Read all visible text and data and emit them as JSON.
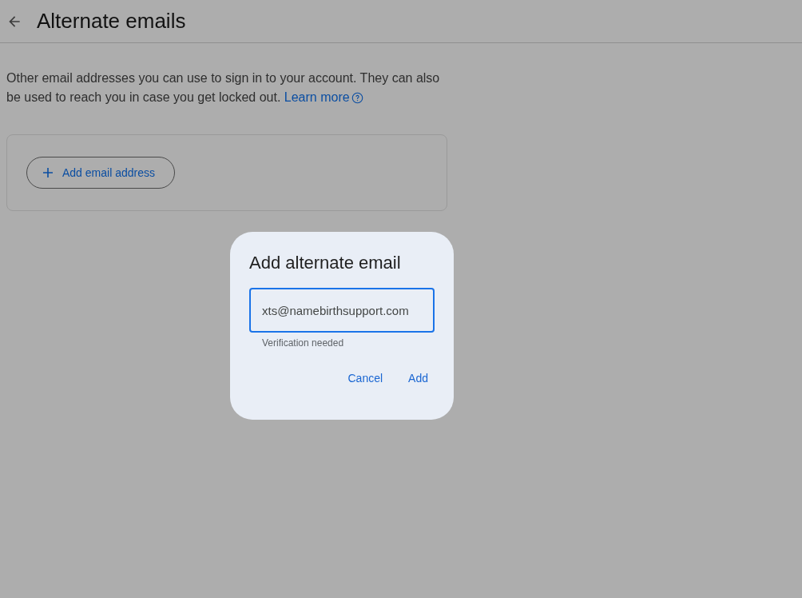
{
  "header": {
    "title": "Alternate emails"
  },
  "description": {
    "text": "Other email addresses you can use to sign in to your account. They can also be used to reach you in case you get locked out.",
    "link": "Learn more"
  },
  "card": {
    "add_button": "Add email address"
  },
  "dialog": {
    "title": "Add alternate email",
    "email_field": {
      "value": "xts@namebirthsupport.com",
      "focused": true
    },
    "helper": "Verification needed",
    "buttons": [
      "Cancel",
      "Add"
    ]
  }
}
